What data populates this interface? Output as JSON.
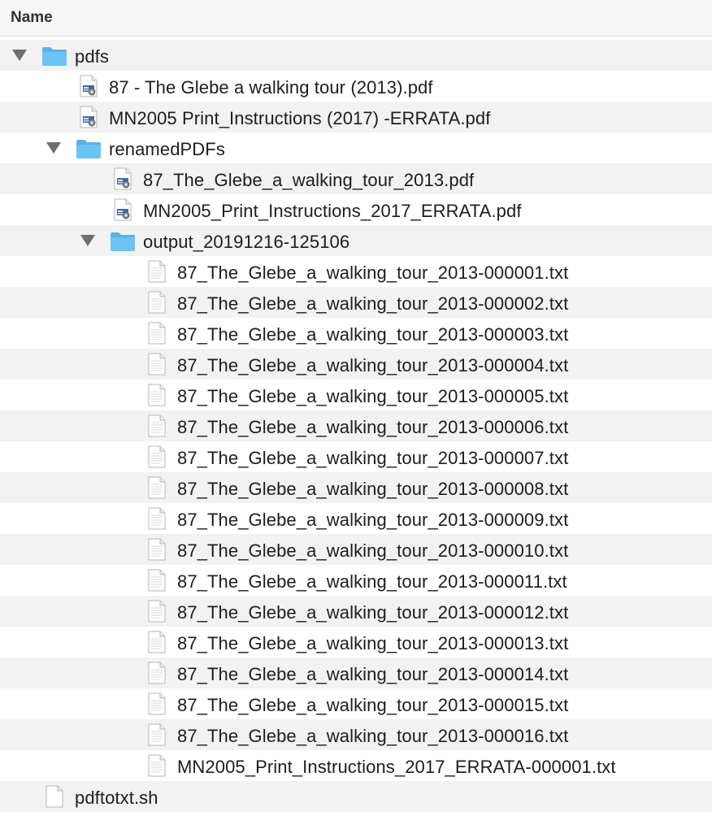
{
  "header": {
    "name_label": "Name"
  },
  "rows": [
    {
      "label": "pdfs",
      "icon": "folder-icon",
      "level": 0,
      "disclosure": true,
      "kind": "folder"
    },
    {
      "label": "87 - The Glebe  a walking tour (2013).pdf",
      "icon": "pdf-file-icon",
      "level": 1,
      "kind": "pdf"
    },
    {
      "label": "MN2005 Print_Instructions (2017) -ERRATA.pdf",
      "icon": "pdf-file-icon",
      "level": 1,
      "kind": "pdf"
    },
    {
      "label": "renamedPDFs",
      "icon": "folder-icon",
      "level": 1,
      "disclosure": true,
      "kind": "folder"
    },
    {
      "label": "87_The_Glebe_a_walking_tour_2013.pdf",
      "icon": "pdf-file-icon",
      "level": 2,
      "kind": "pdf"
    },
    {
      "label": "MN2005_Print_Instructions_2017_ERRATA.pdf",
      "icon": "pdf-file-icon",
      "level": 2,
      "kind": "pdf"
    },
    {
      "label": "output_20191216-125106",
      "icon": "folder-icon",
      "level": 2,
      "disclosure": true,
      "kind": "folder"
    },
    {
      "label": "87_The_Glebe_a_walking_tour_2013-000001.txt",
      "icon": "text-file-icon",
      "level": 3,
      "kind": "txt"
    },
    {
      "label": "87_The_Glebe_a_walking_tour_2013-000002.txt",
      "icon": "text-file-icon",
      "level": 3,
      "kind": "txt"
    },
    {
      "label": "87_The_Glebe_a_walking_tour_2013-000003.txt",
      "icon": "text-file-icon",
      "level": 3,
      "kind": "txt"
    },
    {
      "label": "87_The_Glebe_a_walking_tour_2013-000004.txt",
      "icon": "text-file-icon",
      "level": 3,
      "kind": "txt"
    },
    {
      "label": "87_The_Glebe_a_walking_tour_2013-000005.txt",
      "icon": "text-file-icon",
      "level": 3,
      "kind": "txt"
    },
    {
      "label": "87_The_Glebe_a_walking_tour_2013-000006.txt",
      "icon": "text-file-icon",
      "level": 3,
      "kind": "txt"
    },
    {
      "label": "87_The_Glebe_a_walking_tour_2013-000007.txt",
      "icon": "text-file-icon",
      "level": 3,
      "kind": "txt"
    },
    {
      "label": "87_The_Glebe_a_walking_tour_2013-000008.txt",
      "icon": "text-file-icon",
      "level": 3,
      "kind": "txt"
    },
    {
      "label": "87_The_Glebe_a_walking_tour_2013-000009.txt",
      "icon": "text-file-icon",
      "level": 3,
      "kind": "txt"
    },
    {
      "label": "87_The_Glebe_a_walking_tour_2013-000010.txt",
      "icon": "text-file-icon",
      "level": 3,
      "kind": "txt"
    },
    {
      "label": "87_The_Glebe_a_walking_tour_2013-000011.txt",
      "icon": "text-file-icon",
      "level": 3,
      "kind": "txt"
    },
    {
      "label": "87_The_Glebe_a_walking_tour_2013-000012.txt",
      "icon": "text-file-icon",
      "level": 3,
      "kind": "txt"
    },
    {
      "label": "87_The_Glebe_a_walking_tour_2013-000013.txt",
      "icon": "text-file-icon",
      "level": 3,
      "kind": "txt"
    },
    {
      "label": "87_The_Glebe_a_walking_tour_2013-000014.txt",
      "icon": "text-file-icon",
      "level": 3,
      "kind": "txt"
    },
    {
      "label": "87_The_Glebe_a_walking_tour_2013-000015.txt",
      "icon": "text-file-icon",
      "level": 3,
      "kind": "txt"
    },
    {
      "label": "87_The_Glebe_a_walking_tour_2013-000016.txt",
      "icon": "text-file-icon",
      "level": 3,
      "kind": "txt"
    },
    {
      "label": "MN2005_Print_Instructions_2017_ERRATA-000001.txt",
      "icon": "text-file-icon",
      "level": 3,
      "kind": "txt"
    },
    {
      "label": "pdftotxt.sh",
      "icon": "shell-script-file-icon",
      "level": 0,
      "kind": "script"
    }
  ],
  "colors": {
    "folder": "#6cc3f4",
    "folder_tab": "#5ab2e8",
    "row_alt": "#f2f2f2",
    "disclosure": "#6e6e6e"
  }
}
